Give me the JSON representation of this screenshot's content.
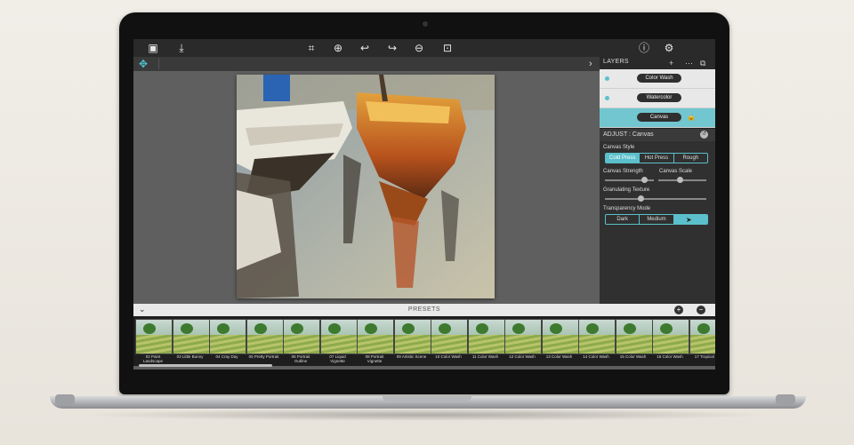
{
  "toolbar": {
    "icons": [
      "crop-icon",
      "zoom-in-icon",
      "undo-icon",
      "redo-icon",
      "zoom-out-icon",
      "fit-screen-icon"
    ],
    "left_icons": [
      "image-icon",
      "save-icon"
    ],
    "right_icons": [
      "info-icon",
      "settings-icon"
    ]
  },
  "layers": {
    "title": "LAYERS",
    "add": "+",
    "items": [
      {
        "label": "Color Wash"
      },
      {
        "label": "Watercolor"
      },
      {
        "label": "Canvas"
      }
    ]
  },
  "adjust": {
    "title": "ADJUST : Canvas",
    "canvas_style_label": "Canvas Style",
    "canvas_style_options": [
      "Cold Press",
      "Hot Press",
      "Rough"
    ],
    "canvas_style_selected": "Cold Press",
    "canvas_strength_label": "Canvas Strength",
    "canvas_strength_value": 0.8,
    "canvas_scale_label": "Canvas Scale",
    "canvas_scale_value": 0.45,
    "granulating_label": "Granulating Texture",
    "granulating_value": 0.35,
    "transparency_label": "Transparency Mode",
    "transparency_options": [
      "Dark",
      "Medium",
      ""
    ],
    "transparency_selected": 2
  },
  "presets": {
    "title": "PRESETS",
    "items": [
      {
        "l1": "02 Paint",
        "l2": "Landscape"
      },
      {
        "l1": "03 Little Bunny",
        "l2": ""
      },
      {
        "l1": "04 Cray Day",
        "l2": ""
      },
      {
        "l1": "05 Pretty Portrait",
        "l2": ""
      },
      {
        "l1": "06 Portrait",
        "l2": "Outline"
      },
      {
        "l1": "07 Liquid",
        "l2": "Vignette"
      },
      {
        "l1": "08 Portrait",
        "l2": "Vignette"
      },
      {
        "l1": "09 Artistic Scene",
        "l2": ""
      },
      {
        "l1": "10 Color Wash",
        "l2": ""
      },
      {
        "l1": "11 Color Wash",
        "l2": ""
      },
      {
        "l1": "12 Color Wash",
        "l2": ""
      },
      {
        "l1": "13 Color Wash",
        "l2": ""
      },
      {
        "l1": "14 Color Wash",
        "l2": ""
      },
      {
        "l1": "15 Color Wash",
        "l2": ""
      },
      {
        "l1": "16 Color Wash",
        "l2": ""
      },
      {
        "l1": "17 Tropical W",
        "l2": ""
      }
    ]
  },
  "colors": {
    "accent": "#5bc0cc",
    "panel": "#303030",
    "toolbar": "#2a2a2a"
  }
}
